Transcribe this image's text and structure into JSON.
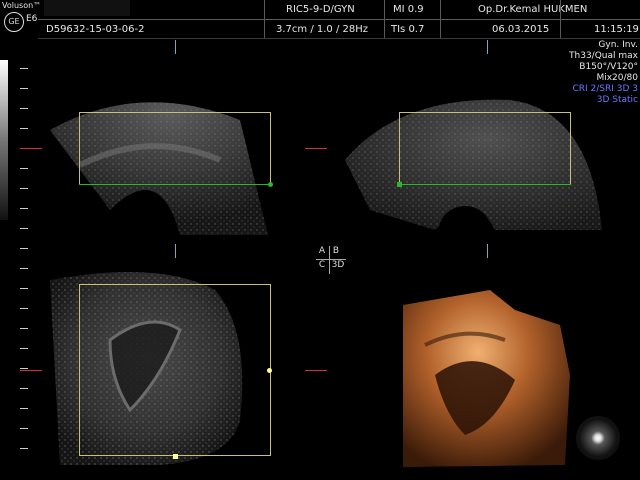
{
  "header": {
    "brand": "Voluson™",
    "model": "E6",
    "probe": "RIC5-9-D/GYN",
    "mi": "MI  0.9",
    "doctor": "Op.Dr.Kemal HUKMEN",
    "patient_id": "D59632-15-03-06-2",
    "depth_freq": "3.7cm / 1.0 / 28Hz",
    "tis": "TIs  0.7",
    "date": "06.03.2015",
    "time": "11:15:19"
  },
  "settings": {
    "lines": [
      "Gyn. Inv.",
      "Th33/Qual max",
      "B150°/V120°",
      "Mix20/80"
    ],
    "mode_lines": [
      "CRI 2/SRI 3D 3",
      "3D Static"
    ]
  },
  "quad_labels": {
    "a": "A",
    "b": "B",
    "c": "C",
    "d": "3D"
  },
  "colors": {
    "roi": "#c7c27a",
    "crosshair_green": "#2db52d",
    "marker_red": "#cc3333",
    "render_orange": "#c06a2a",
    "mode_blue": "#6a74ff"
  }
}
